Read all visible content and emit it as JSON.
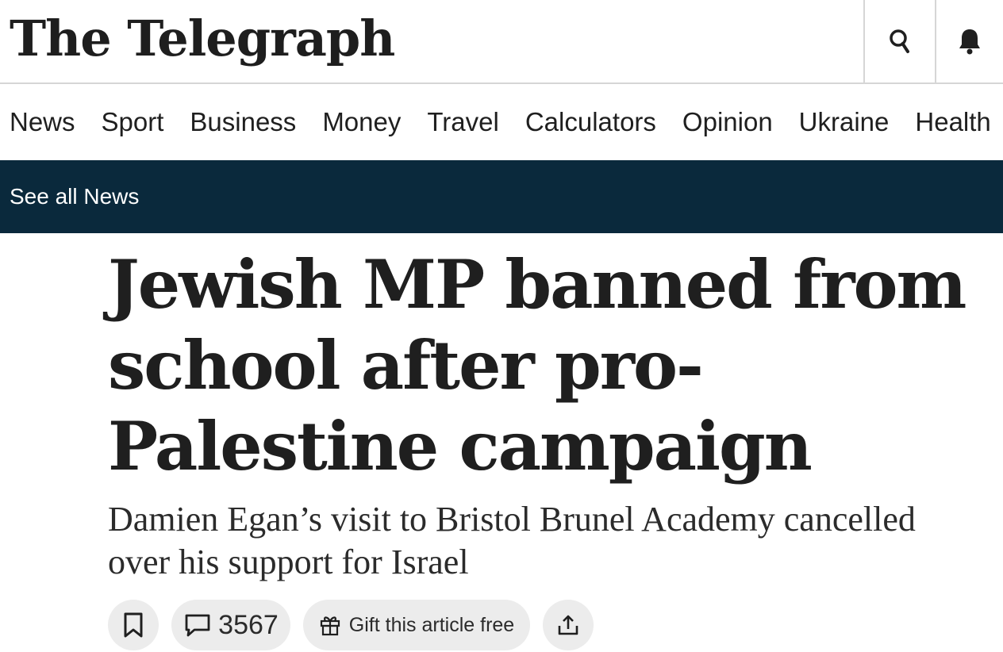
{
  "header": {
    "logo_text": "The Telegraph",
    "icons": [
      "search-icon",
      "bell-icon"
    ]
  },
  "nav": {
    "items": [
      "News",
      "Sport",
      "Business",
      "Money",
      "Travel",
      "Calculators",
      "Opinion",
      "Ukraine",
      "Health"
    ]
  },
  "subnav": {
    "link": "See all News",
    "background": "#0a293c"
  },
  "article": {
    "headline": "Jewish MP banned from school after pro-Palestine campaign",
    "standfirst": "Damien Egan’s visit to Bristol Brunel Academy cancelled over his support for Israel"
  },
  "actions": {
    "bookmark_icon": "bookmark-icon",
    "comment_icon": "comment-icon",
    "comment_count": "3567",
    "gift_icon": "gift-icon",
    "gift_label": "Gift this article free",
    "share_icon": "share-icon"
  }
}
